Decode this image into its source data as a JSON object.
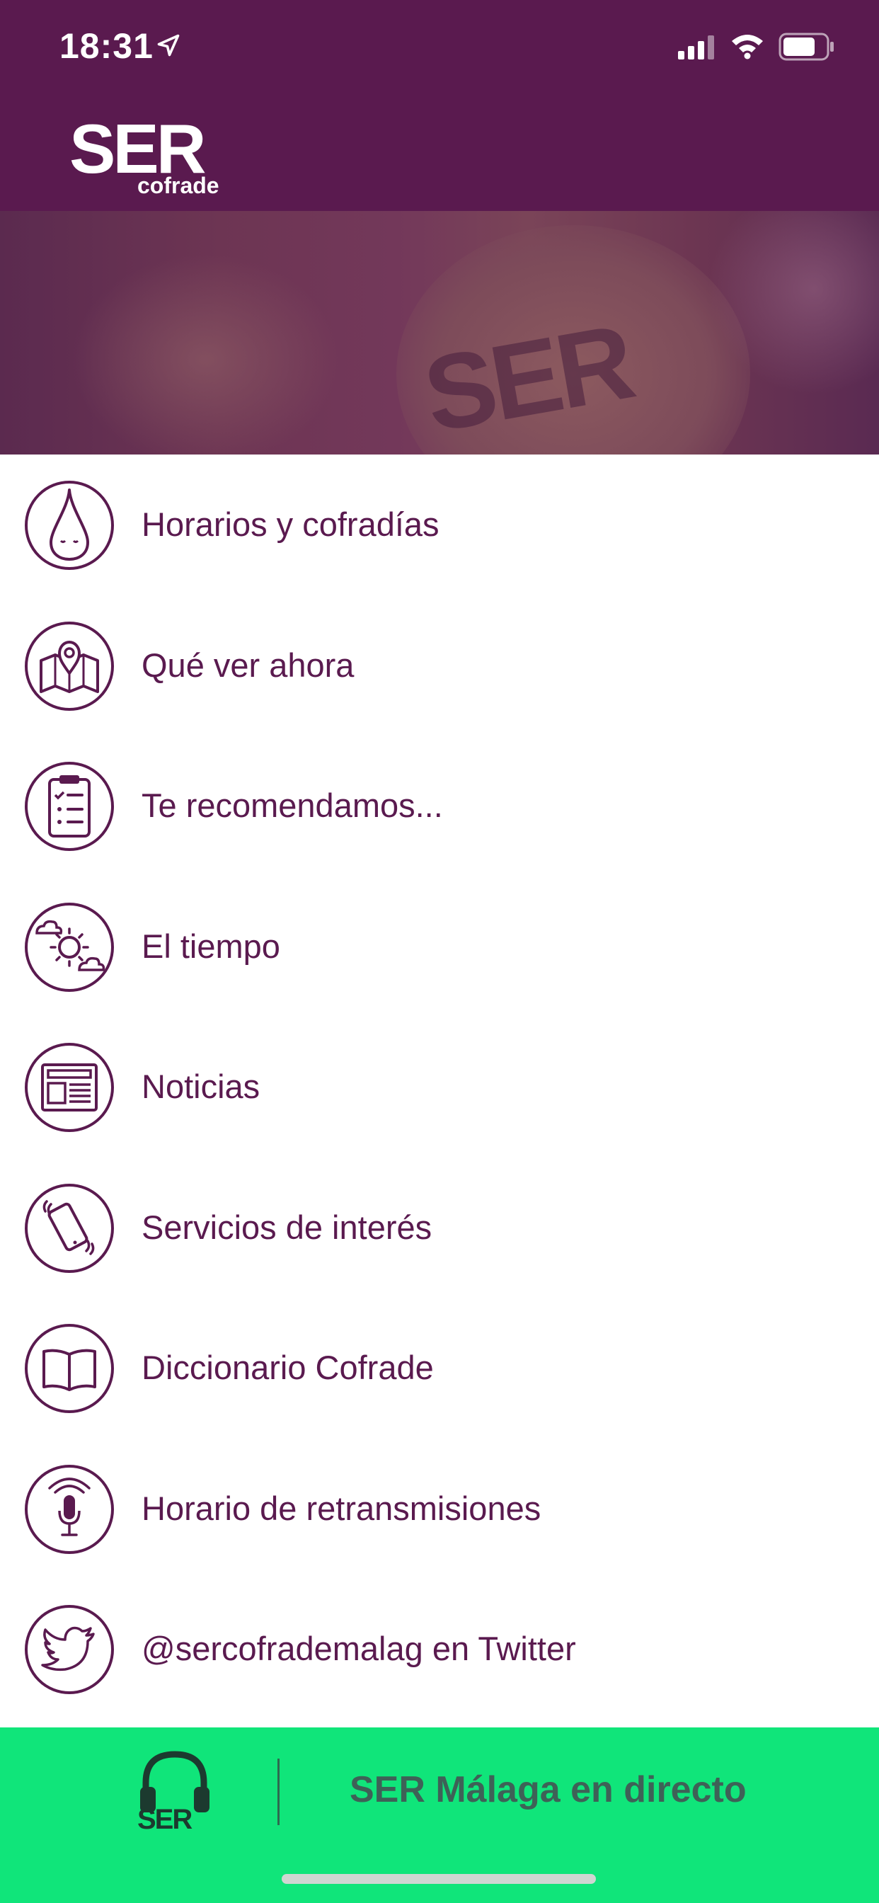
{
  "status_bar": {
    "time": "18:31",
    "location_icon": "location-arrow-icon",
    "signal_icon": "cellular-signal-icon",
    "wifi_icon": "wifi-icon",
    "battery_icon": "battery-icon"
  },
  "header": {
    "logo_text": "SER",
    "logo_subtext": "cofrade",
    "background_color": "#5a1a4f"
  },
  "banner": {
    "watermark_text": "SER"
  },
  "menu": {
    "text_color": "#5a1a4f",
    "items": [
      {
        "label": "Horarios y cofradías",
        "icon": "nazareno-hood-icon"
      },
      {
        "label": "Qué ver ahora",
        "icon": "map-pin-icon"
      },
      {
        "label": "Te recomendamos...",
        "icon": "clipboard-checklist-icon"
      },
      {
        "label": "El tiempo",
        "icon": "weather-sun-cloud-icon"
      },
      {
        "label": "Noticias",
        "icon": "newspaper-icon"
      },
      {
        "label": "Servicios de interés",
        "icon": "phone-vibrate-icon"
      },
      {
        "label": "Diccionario Cofrade",
        "icon": "open-book-icon"
      },
      {
        "label": "Horario de retransmisiones",
        "icon": "podcast-microphone-icon"
      },
      {
        "label": "@sercofrademalag en Twitter",
        "icon": "twitter-bird-icon"
      }
    ]
  },
  "player": {
    "brand": "SER",
    "label": "SER Málaga en directo",
    "background_color": "#10e57a",
    "icon": "headphones-icon"
  }
}
